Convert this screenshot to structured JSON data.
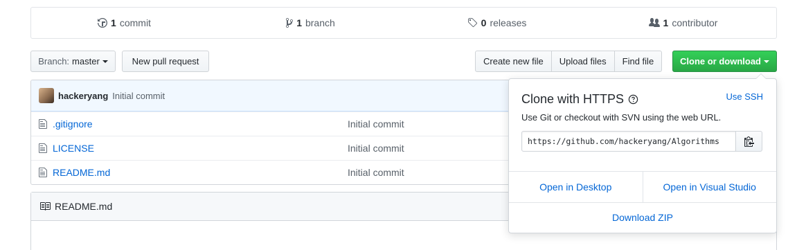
{
  "numbers": {
    "commits": {
      "count": "1",
      "label": "commit"
    },
    "branches": {
      "count": "1",
      "label": "branch"
    },
    "releases": {
      "count": "0",
      "label": "releases"
    },
    "contributors": {
      "count": "1",
      "label": "contributor"
    }
  },
  "toolbar": {
    "branch_prefix": "Branch:",
    "branch_name": "master",
    "new_pull_request": "New pull request",
    "create_new_file": "Create new file",
    "upload_files": "Upload files",
    "find_file": "Find file",
    "clone_or_download": "Clone or download"
  },
  "commit": {
    "author": "hackeryang",
    "message": "Initial commit"
  },
  "files": [
    {
      "name": ".gitignore",
      "message": "Initial commit"
    },
    {
      "name": "LICENSE",
      "message": "Initial commit"
    },
    {
      "name": "README.md",
      "message": "Initial commit"
    }
  ],
  "readme": {
    "title": "README.md"
  },
  "clone_popover": {
    "title": "Clone with HTTPS",
    "use_ssh": "Use SSH",
    "description": "Use Git or checkout with SVN using the web URL.",
    "url": "https://github.com/hackeryang/Algorithms",
    "open_desktop": "Open in Desktop",
    "open_visual_studio": "Open in Visual Studio",
    "download_zip": "Download ZIP"
  },
  "colors": {
    "accent_link": "#0366d6",
    "clone_button": "#28a745",
    "commit_bar": "#f1f8ff"
  }
}
